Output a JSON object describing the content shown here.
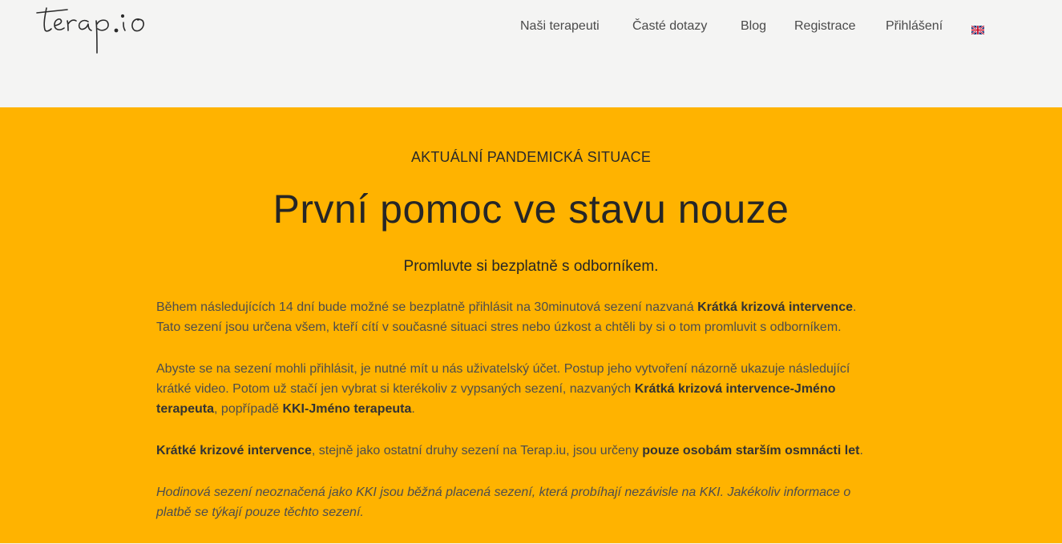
{
  "header": {
    "logo_text": "terap.io",
    "nav": [
      {
        "label": "Naši terapeuti"
      },
      {
        "label": "Časté dotazy"
      },
      {
        "label": "Blog"
      },
      {
        "label": "Registrace"
      },
      {
        "label": "Přihlášení"
      }
    ],
    "language_icon": "uk-flag-icon"
  },
  "hero": {
    "kicker": "AKTUÁLNÍ PANDEMICKÁ SITUACE",
    "title": "První pomoc ve stavu nouze",
    "subtitle": "Promluvte si bezplatně s odborníkem.",
    "p1": {
      "t1": "Během následujících 14 dní bude možné se bezplatně přihlásit na 30minutová sezení nazvaná ",
      "b1": "Krátká krizová intervence",
      "t2": ". Tato sezení jsou určena všem, kteří cítí v současné situaci stres nebo úzkost a chtěli by si o tom promluvit s odborníkem."
    },
    "p2": {
      "t1": "Abyste se na sezení mohli přihlásit, je nutné mít u nás uživatelský účet. Postup jeho vytvoření názorně ukazuje následující krátké video. Potom už stačí jen vybrat si kterékoliv z vypsaných sezení, nazvaných ",
      "b1": "Krátká krizová intervence-Jméno terapeuta",
      "t2": ", popřípadě ",
      "b2": "KKI-Jméno terapeuta",
      "t3": "."
    },
    "p3": {
      "b1": "Krátké krizové intervence",
      "t1": ", stejně jako ostatní druhy sezení na Terap.iu, jsou určeny ",
      "b2": "pouze osobám starším osmnácti let",
      "t2": "."
    },
    "p4": "Hodinová sezení neoznačená jako KKI jsou běžná placená sezení, která probíhají nezávisle na KKI. Jakékoliv informace o platbě se týkají pouze těchto sezení."
  },
  "colors": {
    "header_bg": "#f4f4f3",
    "hero_bg": "#ffb300",
    "text": "#4d4d4d"
  }
}
